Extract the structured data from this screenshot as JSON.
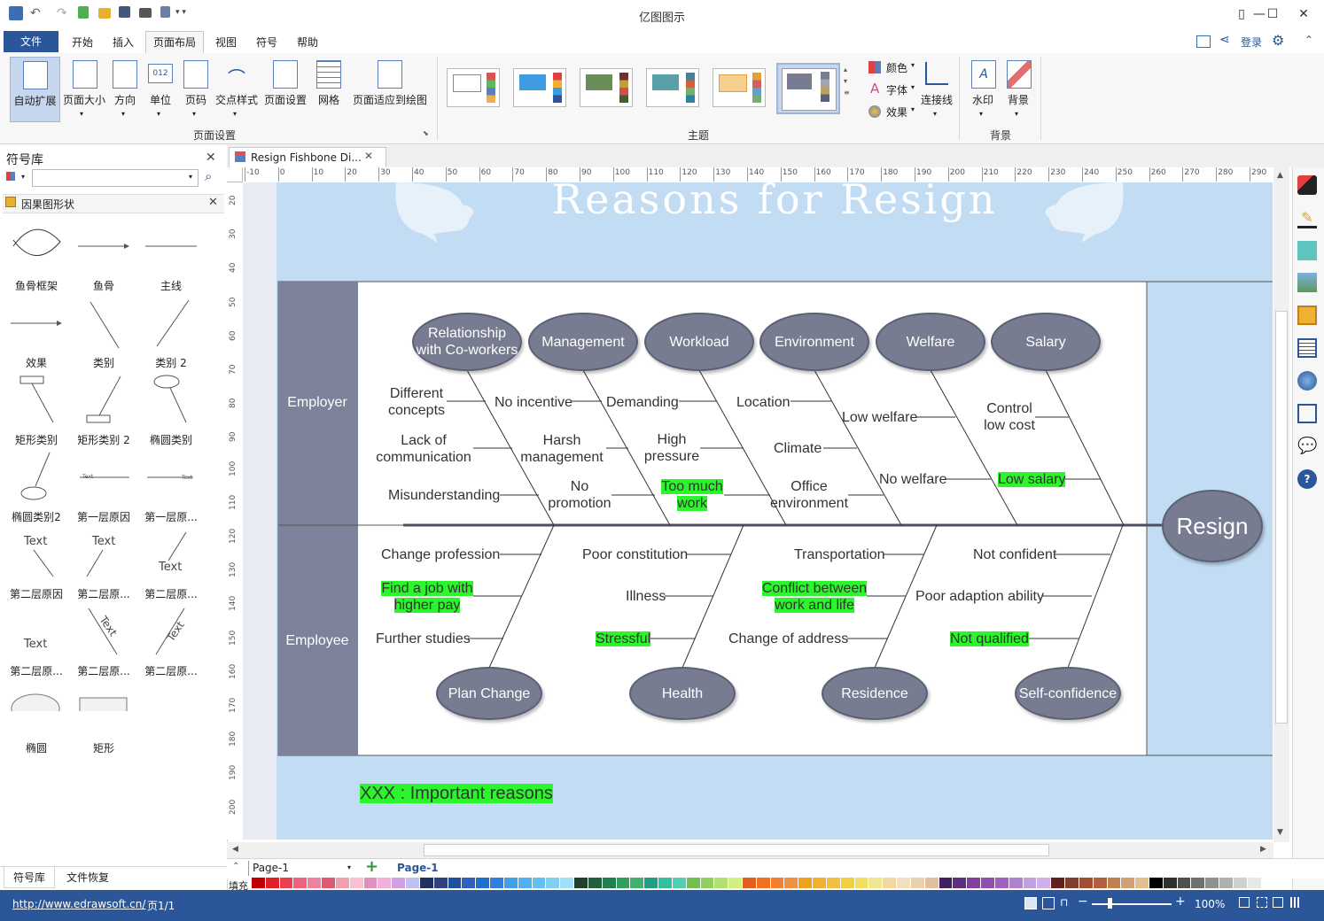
{
  "app": {
    "title": "亿图图示"
  },
  "menu": {
    "file": "文件",
    "items": [
      "开始",
      "插入",
      "页面布局",
      "视图",
      "符号",
      "帮助"
    ],
    "login": "登录"
  },
  "ribbon": {
    "page_setup": {
      "label": "页面设置",
      "buttons": [
        "自动扩展",
        "页面大小",
        "方向",
        "单位",
        "页码",
        "交点样式",
        "页面设置",
        "网格",
        "页面适应到绘图"
      ]
    },
    "theme": {
      "label": "主题",
      "options": [
        "颜色",
        "字体",
        "效果"
      ],
      "connector": "连接线"
    },
    "background": {
      "label": "背景",
      "buttons": [
        "水印",
        "背景"
      ]
    }
  },
  "left_panel": {
    "title": "符号库",
    "search_placeholder": "",
    "library": "因果图形状",
    "shapes": [
      "鱼骨框架",
      "鱼骨",
      "主线",
      "效果",
      "类别",
      "类别 2",
      "矩形类别",
      "矩形类别 2",
      "椭圆类别",
      "椭圆类别2",
      "第一层原因",
      "第一层原...",
      "第二层原因",
      "第二层原...",
      "第二层原...",
      "第二层原...",
      "第二层原...",
      "第二层原...",
      "椭圆",
      "矩形"
    ],
    "shape_sample_text": "Text",
    "bottom_tabs": [
      "符号库",
      "文件恢复"
    ]
  },
  "doc_tab": {
    "title": "Resign Fishbone Di..."
  },
  "ruler": {
    "h": [
      "-10",
      "0",
      "10",
      "20",
      "30",
      "40",
      "50",
      "60",
      "70",
      "80",
      "90",
      "100",
      "110",
      "120",
      "130",
      "140",
      "150",
      "160",
      "170",
      "180",
      "190",
      "200",
      "210",
      "220",
      "230",
      "240",
      "250",
      "260",
      "270",
      "280",
      "290"
    ],
    "v": [
      "20",
      "30",
      "40",
      "50",
      "60",
      "70",
      "80",
      "90",
      "100",
      "110",
      "120",
      "130",
      "140",
      "150",
      "160",
      "170",
      "180",
      "190",
      "200"
    ]
  },
  "diagram": {
    "title": "Reasons for Resign",
    "effect": "Resign",
    "sections": [
      "Employer",
      "Employee"
    ],
    "top_categories": [
      "Relationship with Co-workers",
      "Management",
      "Workload",
      "Environment",
      "Welfare",
      "Salary"
    ],
    "bottom_categories": [
      "Plan Change",
      "Health",
      "Residence",
      "Self-confidence"
    ],
    "causes": {
      "relationship": [
        "Different concepts",
        "Lack of communication",
        "Misunderstanding"
      ],
      "management": [
        "No incentive",
        "Harsh management",
        "No promotion"
      ],
      "workload": [
        "Demanding",
        "High pressure",
        "Too much work"
      ],
      "environment": [
        "Location",
        "Climate",
        "Office environment"
      ],
      "welfare": [
        "Low welfare",
        "No welfare"
      ],
      "salary": [
        "Control low cost",
        "Low salary"
      ],
      "plan_change": [
        "Change profession",
        "Find a job with higher pay",
        "Further studies"
      ],
      "health": [
        "Poor constitution",
        "Illness",
        "Stressful"
      ],
      "residence": [
        "Transportation",
        "Conflict between work and life",
        "Change of address"
      ],
      "self_confidence": [
        "Not confident",
        "Poor adaption ability",
        "Not qualified"
      ]
    },
    "legend": "XXX : Important reasons",
    "highlight_color": "#2bf52b"
  },
  "pages": {
    "current": "Page-1",
    "tab": "Page-1"
  },
  "fill_label": "填充",
  "status": {
    "url": "http://www.edrawsoft.cn/",
    "page": "页1/1",
    "zoom": "100%"
  }
}
